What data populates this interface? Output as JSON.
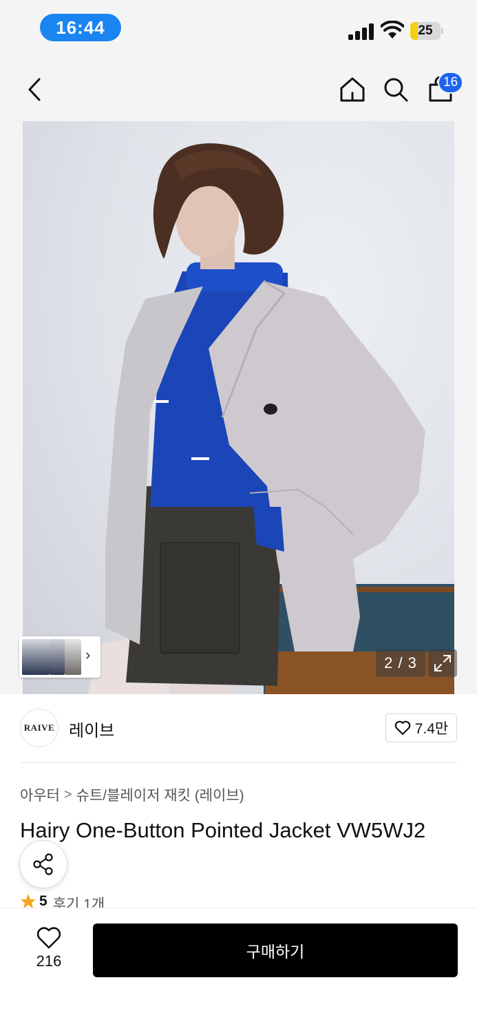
{
  "status_bar": {
    "time": "16:44",
    "battery_level": "25",
    "battery_fraction": 0.25
  },
  "header": {
    "cart_count": "16"
  },
  "gallery": {
    "counter": "2 / 3"
  },
  "brand": {
    "logo_text": "RAIVE",
    "name": "레이브",
    "likes": "7.4만"
  },
  "product": {
    "category": [
      "아우터",
      "슈트/블레이저 재킷 (레이브)"
    ],
    "category_separator": ">",
    "title": "Hairy One-Button Pointed Jacket VW5WJ2 color",
    "rating": "5",
    "review_text": "후기 1개"
  },
  "bottom_bar": {
    "like_count": "216",
    "buy_label": "구매하기"
  },
  "colors": {
    "accent_blue": "#1e63ef",
    "time_pill": "#1a84f0",
    "buy_button": "#000000",
    "star": "#f5a623"
  }
}
